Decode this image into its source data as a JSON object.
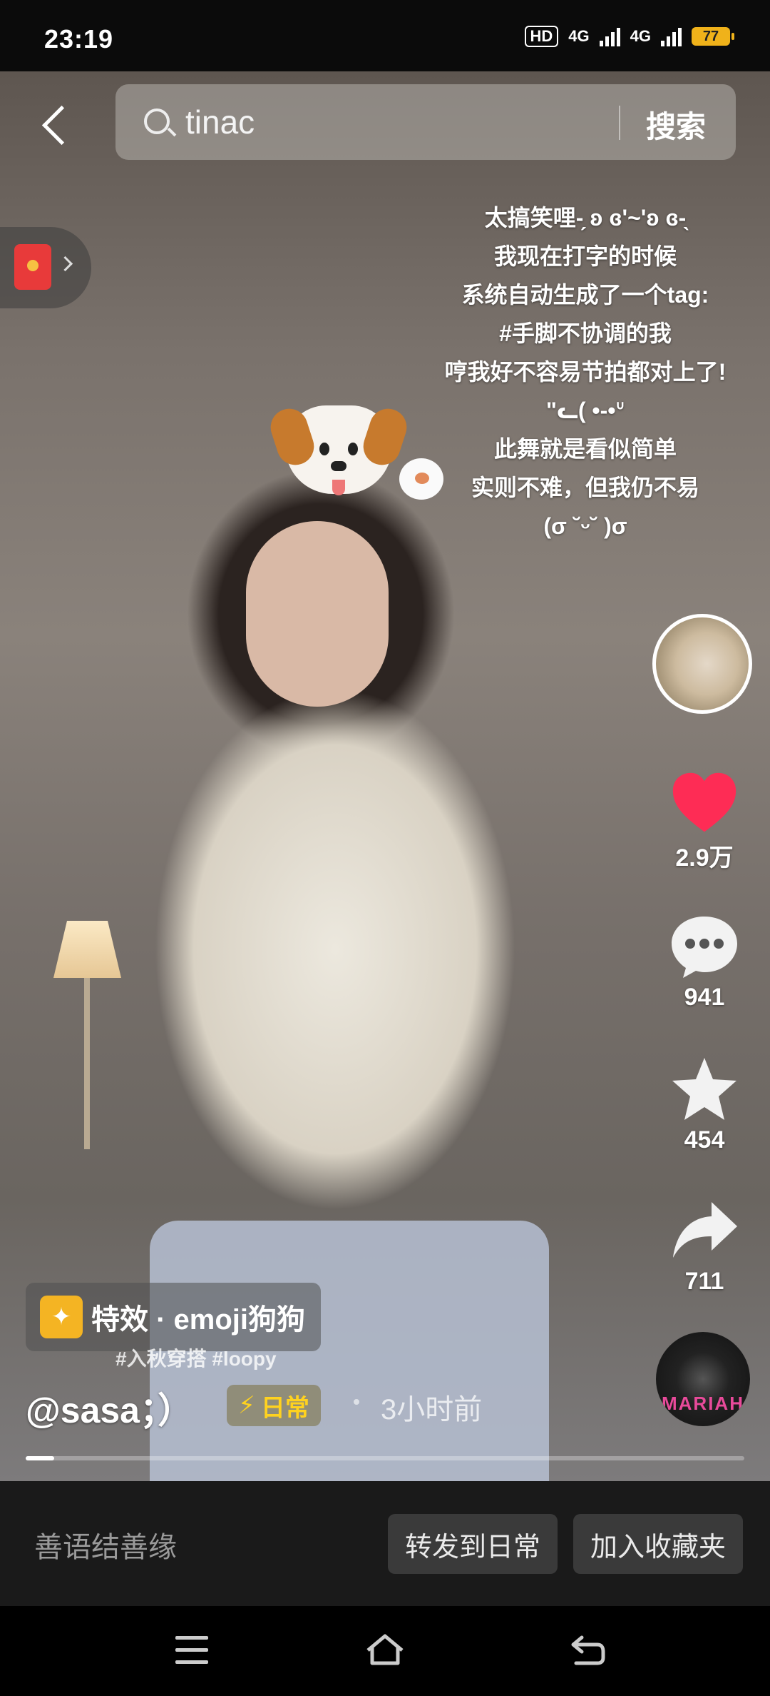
{
  "status_bar": {
    "time": "23:19",
    "hd_badge": "HD",
    "net1": "4G",
    "net2": "4G",
    "battery": "77"
  },
  "search": {
    "query": "tinac",
    "button": "搜索"
  },
  "caption_lines": [
    "太搞笑哩-̗ ʚ ɞ'~'ʚ ɞ-̖",
    "我现在打字的时候",
    "系统自动生成了一个tag:",
    "#手脚不协调的我",
    "哼我好不容易节拍都对上了!",
    "\"ᓚ( •‐•ᐡ",
    "此舞就是看似简单",
    "实则不难，但我仍不易",
    "(σ ˘ᵕ˘ )σ"
  ],
  "actions": {
    "likes": "2.9万",
    "comments": "941",
    "favorites": "454",
    "shares": "711"
  },
  "effect": {
    "label": "特效 · emoji狗狗"
  },
  "tags": "#入秋穿搭 #loopy",
  "author": "@sasa；）",
  "daily_badge": "日常",
  "time_ago": "3小时前",
  "music_label": "MARIAH",
  "progress": 0.04,
  "comment_bar": {
    "placeholder": "善语结善缘",
    "btn_forward": "转发到日常",
    "btn_collect": "加入收藏夹"
  },
  "colors": {
    "like": "#fe2c55",
    "daily": "#ffd21f",
    "effect_icon": "#f4b423"
  },
  "icons": [
    "back-icon",
    "search-icon",
    "red-packet-icon",
    "heart-icon",
    "comment-icon",
    "star-icon",
    "share-icon",
    "lightning-icon",
    "menu-icon",
    "home-icon",
    "nav-back-icon"
  ]
}
